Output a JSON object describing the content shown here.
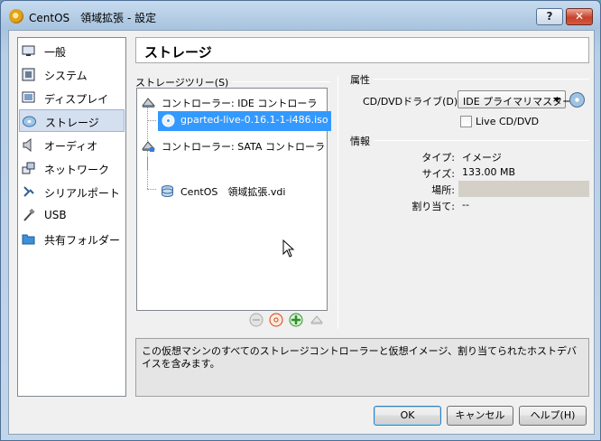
{
  "window": {
    "title": "CentOS　領域拡張 - 設定",
    "help_button": "?",
    "close_button": "✕"
  },
  "sidebar": {
    "items": [
      {
        "label": "一般",
        "icon": "general-icon"
      },
      {
        "label": "システム",
        "icon": "system-icon"
      },
      {
        "label": "ディスプレイ",
        "icon": "display-icon"
      },
      {
        "label": "ストレージ",
        "icon": "storage-icon",
        "selected": true
      },
      {
        "label": "オーディオ",
        "icon": "audio-icon"
      },
      {
        "label": "ネットワーク",
        "icon": "network-icon"
      },
      {
        "label": "シリアルポート",
        "icon": "serial-port-icon"
      },
      {
        "label": "USB",
        "icon": "usb-icon"
      },
      {
        "label": "共有フォルダー",
        "icon": "shared-folder-icon"
      }
    ]
  },
  "header": {
    "title": "ストレージ"
  },
  "storage_tree": {
    "label": "ストレージツリー(S)",
    "controllers": [
      {
        "label": "コントローラー: IDE コントローラ",
        "devices": [
          "gparted-live-0.16.1-1-i486.iso"
        ]
      },
      {
        "label": "コントローラー: SATA コントローラ",
        "devices": [
          "CentOS　領域拡張.vdi"
        ]
      }
    ],
    "selected_device": "gparted-live-0.16.1-1-i486.iso"
  },
  "attributes": {
    "section_label": "属性",
    "drive_label": "CD/DVDドライブ(D):",
    "drive_value": "IDE プライマリマスター",
    "live_cd_label": "Live CD/DVD",
    "live_cd_checked": false
  },
  "info": {
    "section_label": "情報",
    "rows": [
      {
        "label": "タイプ:",
        "value": "イメージ"
      },
      {
        "label": "サイズ:",
        "value": "133.00 MB"
      },
      {
        "label": "場所:",
        "value": ""
      },
      {
        "label": "割り当て:",
        "value": "--"
      }
    ]
  },
  "description": "この仮想マシンのすべてのストレージコントローラーと仮想イメージ、割り当てられたホストデバイスを含みます。",
  "buttons": {
    "ok": "OK",
    "cancel": "キャンセル",
    "help": "ヘルプ(H)"
  },
  "colors": {
    "selection": "#3399ff",
    "sidebar_selected": "#d4dff0"
  }
}
